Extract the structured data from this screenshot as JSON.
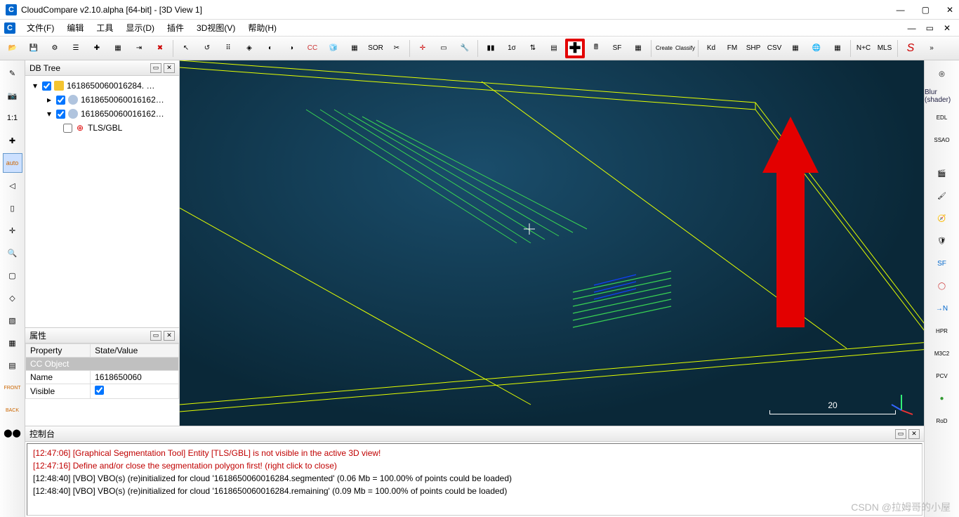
{
  "window": {
    "title": "CloudCompare v2.10.alpha [64-bit] - [3D View 1]",
    "app_badge": "C"
  },
  "menu": {
    "file": "文件(F)",
    "edit": "编辑",
    "tools": "工具",
    "display": "显示(D)",
    "plugins": "插件",
    "view3d": "3D视图(V)",
    "help": "帮助(H)"
  },
  "toolbar": {
    "open": "📂",
    "save": "💾",
    "props": "⚙",
    "list": "☰",
    "plus_colors": "✚",
    "rgb": "▦",
    "merge": "⇥",
    "delete": "✖",
    "pick": "↖",
    "rotate": "↺",
    "points": "⠿",
    "mesh": "◈",
    "alignA": "◐",
    "alignB": "◑",
    "cc": "CC",
    "sample": "🧊",
    "register": "▦",
    "sor": "SOR",
    "scissors": "✂",
    "marker": "✛",
    "eraser": "▭",
    "tool": "🔧",
    "hist": "▮▮",
    "sigma": "1σ",
    "minmax": "⇅",
    "grad": "▤",
    "plusbig": "✚",
    "calc": "🖩",
    "sf": "SF",
    "sfgrad": "▦",
    "canupo_cr": "Create",
    "canupo_cl": "Classify",
    "kd": "Kd",
    "fm": "FM",
    "shp": "SHP",
    "csv": "CSV",
    "grid": "▦",
    "globe": "🌐",
    "vol": "▦",
    "nc": "N+C",
    "mls": "MLS",
    "curve": "S"
  },
  "left_tools": [
    "✎",
    "📷",
    "1:1",
    "✚",
    "auto",
    "◁",
    "▯",
    "✛",
    "🔍",
    "▢",
    "◇",
    "▧",
    "▦",
    "▤",
    "FRONT",
    "BACK",
    "⬤⬤"
  ],
  "right_side": {
    "blur": "Blur (shader)",
    "items": [
      "◎",
      "EDL",
      "SSAO",
      "🎬",
      "🖌",
      "🧭",
      "🛡",
      "SF",
      "◯",
      "→N",
      "HPR",
      "M3C2",
      "PCV",
      "●",
      "RoD"
    ]
  },
  "db": {
    "panel_title": "DB Tree",
    "root": "1618650060016284. …",
    "child1": "1618650060016162…",
    "child2": "1618650060016162…",
    "leaf": "TLS/GBL"
  },
  "props": {
    "title": "属性",
    "col1": "Property",
    "col2": "State/Value",
    "group": "CC Object",
    "name_k": "Name",
    "name_v": "1618650060",
    "vis_k": "Visible"
  },
  "viewport": {
    "scale_label": "20"
  },
  "console": {
    "title": "控制台",
    "lines": [
      {
        "cls": "err",
        "t": "[12:47:06] [Graphical Segmentation Tool] Entity [TLS/GBL] is not visible in the active 3D view!"
      },
      {
        "cls": "err",
        "t": "[12:47:16] Define and/or close the segmentation polygon first! (right click to close)"
      },
      {
        "cls": "",
        "t": "[12:48:40] [VBO] VBO(s) (re)initialized for cloud '1618650060016284.segmented' (0.06 Mb = 100.00% of points could be loaded)"
      },
      {
        "cls": "",
        "t": "[12:48:40] [VBO] VBO(s) (re)initialized for cloud '1618650060016284.remaining' (0.09 Mb = 100.00% of points could be loaded)"
      }
    ]
  },
  "watermark": "CSDN @拉姆哥的小屋"
}
